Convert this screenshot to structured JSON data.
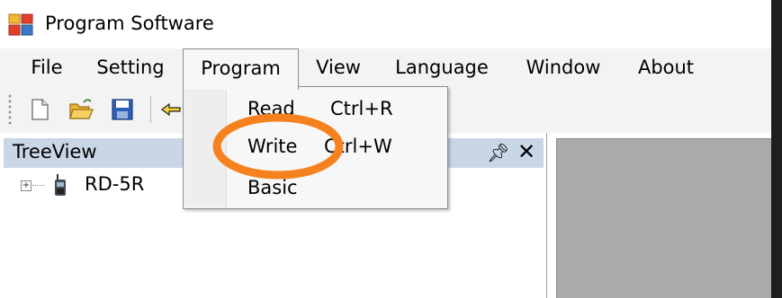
{
  "window": {
    "title": "Program Software",
    "icon": "app-window-icon"
  },
  "menubar": {
    "items": [
      {
        "label": "File"
      },
      {
        "label": "Setting"
      },
      {
        "label": "Program",
        "active": true
      },
      {
        "label": "View"
      },
      {
        "label": "Language"
      },
      {
        "label": "Window"
      },
      {
        "label": "About"
      }
    ]
  },
  "toolbar": {
    "buttons": [
      {
        "icon": "new-file-icon"
      },
      {
        "icon": "open-folder-icon"
      },
      {
        "icon": "save-icon"
      },
      {
        "icon": "arrow-left-icon"
      }
    ]
  },
  "program_menu": {
    "items": [
      {
        "label": "Read",
        "shortcut": "Ctrl+R"
      },
      {
        "label": "Write",
        "shortcut": "Ctrl+W"
      },
      {
        "label": "Basic",
        "shortcut": ""
      }
    ]
  },
  "treeview": {
    "title": "TreeView",
    "pin_icon": "pin-icon",
    "close_icon": "close-icon",
    "nodes": [
      {
        "label": "RD-5R",
        "icon": "radio-icon",
        "expanded": false
      }
    ]
  },
  "annotation": {
    "color": "#f5821f"
  }
}
